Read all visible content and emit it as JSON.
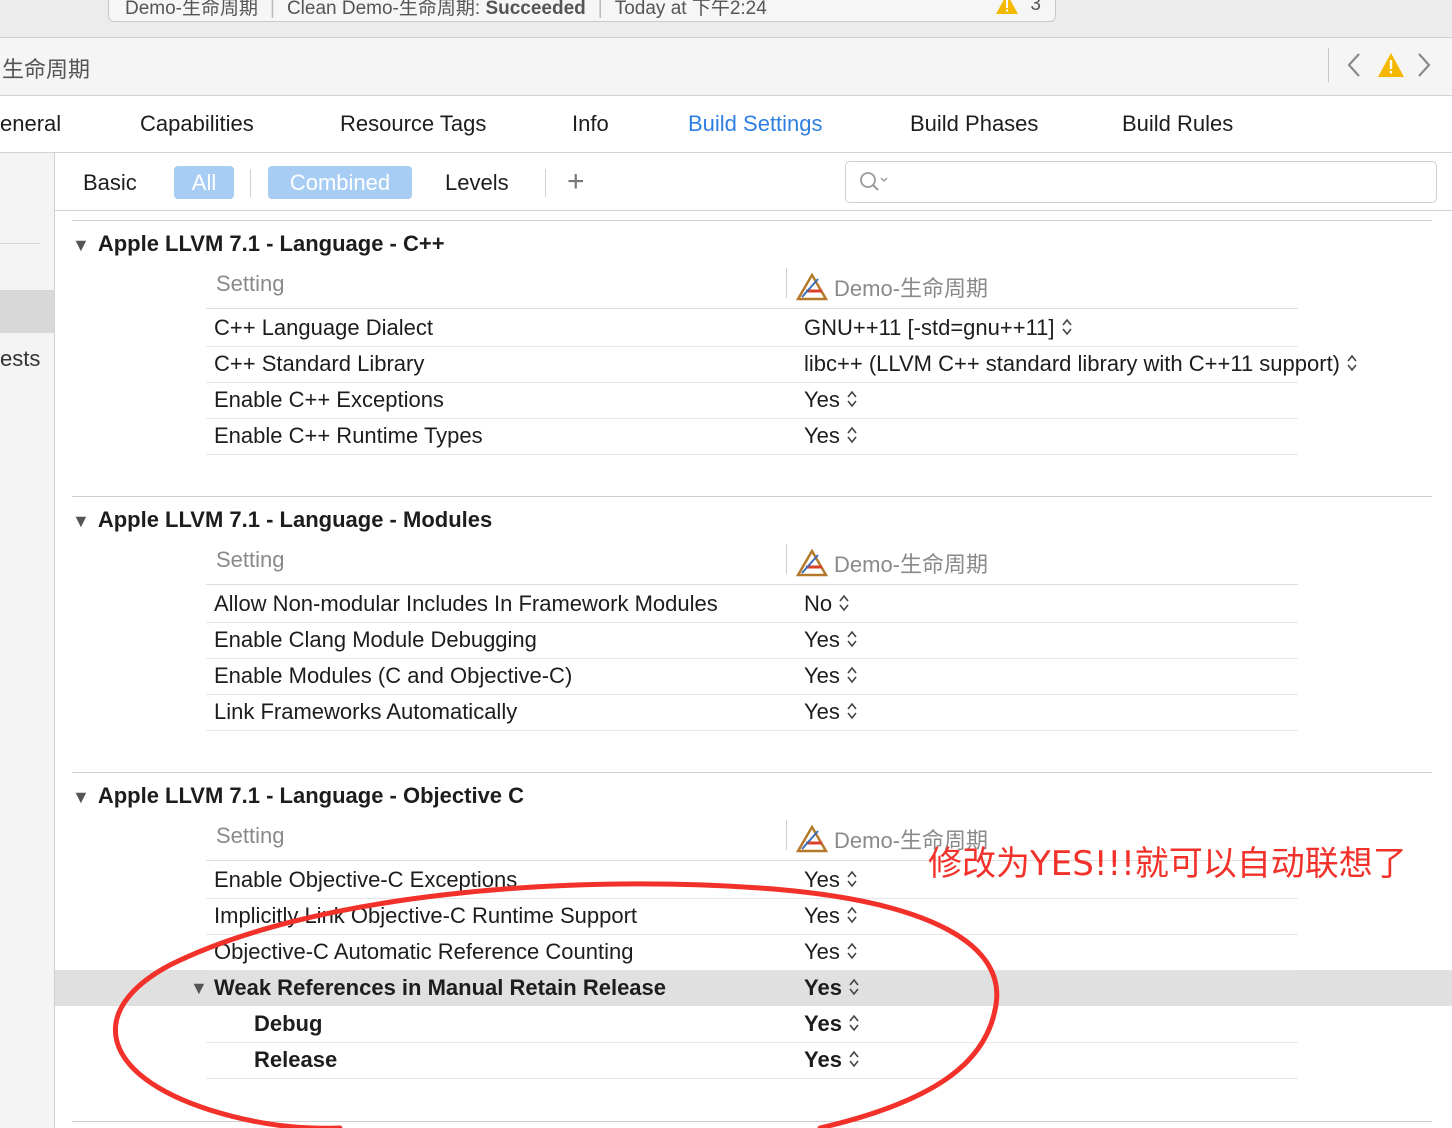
{
  "activity": {
    "scheme": "Demo-生命周期",
    "status_prefix": "Clean Demo-生命周期: ",
    "status": "Succeeded",
    "time": "Today at 下午2:24",
    "warning_count": "3"
  },
  "breadcrumb": {
    "title": "生命周期"
  },
  "tabs": [
    {
      "label": "eneral"
    },
    {
      "label": "Capabilities"
    },
    {
      "label": "Resource Tags"
    },
    {
      "label": "Info"
    },
    {
      "label": "Build Settings"
    },
    {
      "label": "Build Phases"
    },
    {
      "label": "Build Rules"
    }
  ],
  "active_tab": "Build Settings",
  "sidebar": {
    "partial_label": "ests"
  },
  "filter": {
    "basic": "Basic",
    "all": "All",
    "combined": "Combined",
    "levels": "Levels",
    "add": "+"
  },
  "column_header": {
    "setting": "Setting",
    "target": "Demo-生命周期"
  },
  "sections": [
    {
      "title": "Apple LLVM 7.1 - Language - C++",
      "rows": [
        {
          "name": "C++ Language Dialect",
          "value": "GNU++11 [-std=gnu++11]"
        },
        {
          "name": "C++ Standard Library",
          "value": "libc++ (LLVM C++ standard library with C++11 support)"
        },
        {
          "name": "Enable C++ Exceptions",
          "value": "Yes"
        },
        {
          "name": "Enable C++ Runtime Types",
          "value": "Yes"
        }
      ]
    },
    {
      "title": "Apple LLVM 7.1 - Language - Modules",
      "rows": [
        {
          "name": "Allow Non-modular Includes In Framework Modules",
          "value": "No"
        },
        {
          "name": "Enable Clang Module Debugging",
          "value": "Yes"
        },
        {
          "name": "Enable Modules (C and Objective-C)",
          "value": "Yes"
        },
        {
          "name": "Link Frameworks Automatically",
          "value": "Yes"
        }
      ]
    },
    {
      "title": "Apple LLVM 7.1 - Language - Objective C",
      "rows": [
        {
          "name": "Enable Objective-C Exceptions",
          "value": "Yes"
        },
        {
          "name": "Implicitly Link Objective-C Runtime Support",
          "value": "Yes"
        },
        {
          "name": "Objective-C Automatic Reference Counting",
          "value": "Yes"
        },
        {
          "name": "Weak References in Manual Retain Release",
          "value": "Yes"
        },
        {
          "name": "Debug",
          "value": "Yes"
        },
        {
          "name": "Release",
          "value": "Yes"
        }
      ]
    }
  ],
  "annotation": {
    "text": "修改为YES!!!就可以自动联想了"
  },
  "colors": {
    "accent": "#2f7fe0",
    "annotation": "#f2312a",
    "selected_filter": "#a8cdf4",
    "warning": "#f5b800"
  }
}
